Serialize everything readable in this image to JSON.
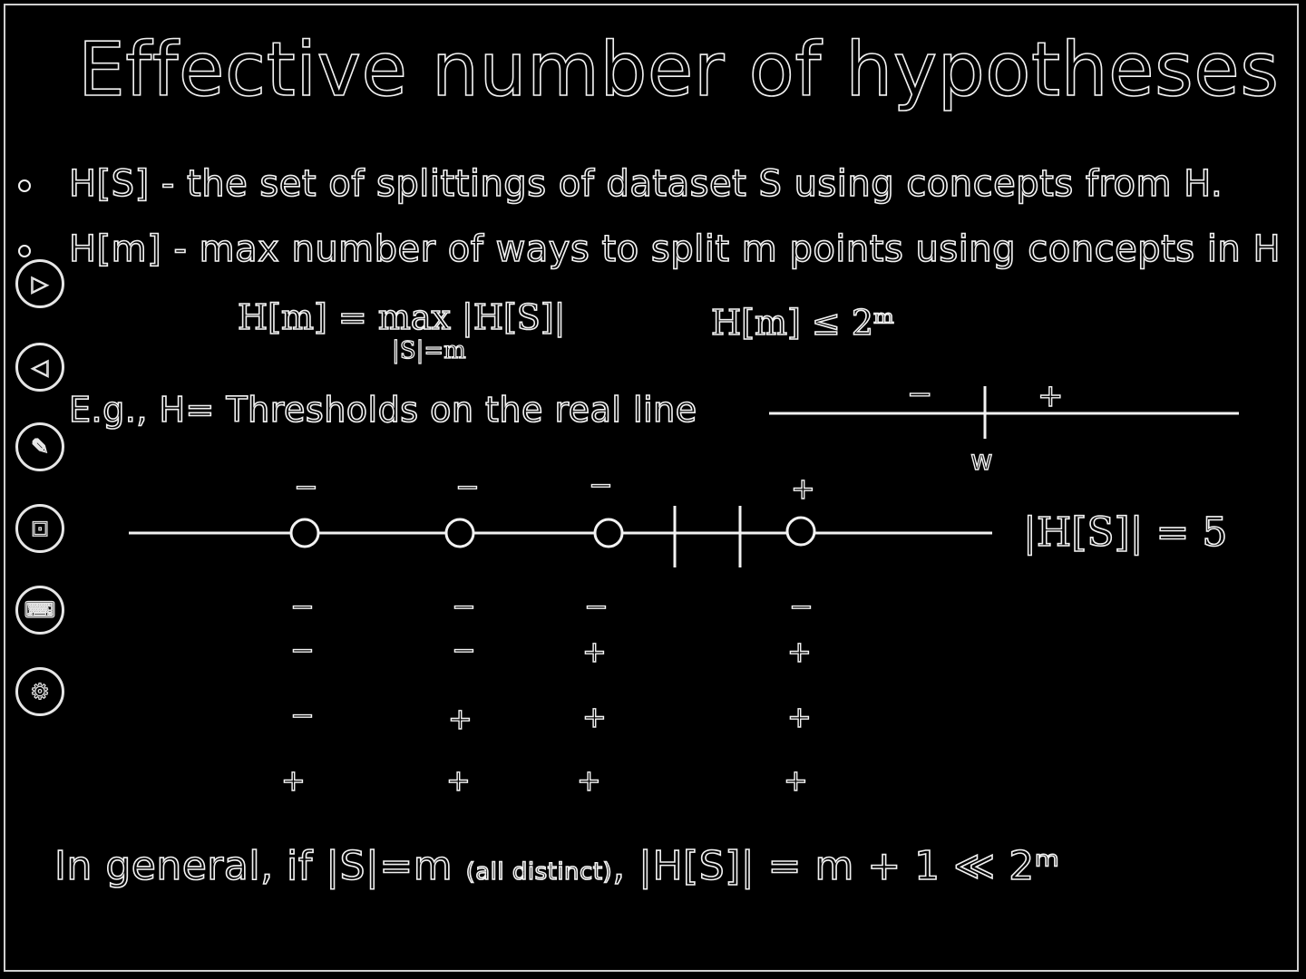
{
  "slide": {
    "title": "Effective number of hypotheses",
    "bullets": [
      "H[S] - the set of splittings of dataset S using concepts from H.",
      "H[m] - max number of ways to split m points using concepts in H"
    ],
    "formula_left": "H[m] = max |H[S]|",
    "formula_left_sub": "|S|=m",
    "formula_right": "H[m] ≤ 2ᵐ",
    "example": "E.g., H= Thresholds on the real line",
    "threshold_labels": {
      "minus": "−",
      "plus": "+",
      "w": "w"
    },
    "point_labels": [
      "−",
      "−",
      "−",
      "+"
    ],
    "count_label": "|H[S]| = 5",
    "labelings": [
      [
        "−",
        "−",
        "−",
        "−"
      ],
      [
        "−",
        "−",
        "+",
        "+"
      ],
      [
        "−",
        "+",
        "+",
        "+"
      ],
      [
        "+",
        "+",
        "+",
        "+"
      ]
    ],
    "general_main": "In general, if |S|=m ",
    "general_small": "(all distinct)",
    "general_end": ", |H[S]| = m + 1 ≪ 2ᵐ"
  },
  "sidebar": {
    "icons": [
      {
        "name": "play-icon",
        "glyph": "▷"
      },
      {
        "name": "volume-icon",
        "glyph": "◁"
      },
      {
        "name": "pen-icon",
        "glyph": "✎"
      },
      {
        "name": "toolbox-icon",
        "glyph": "⊡"
      },
      {
        "name": "keyboard-icon",
        "glyph": "⌨"
      },
      {
        "name": "settings-icon",
        "glyph": "⚙"
      }
    ]
  },
  "colors": {
    "background": "#000000",
    "ink": "#f2f2f2"
  }
}
